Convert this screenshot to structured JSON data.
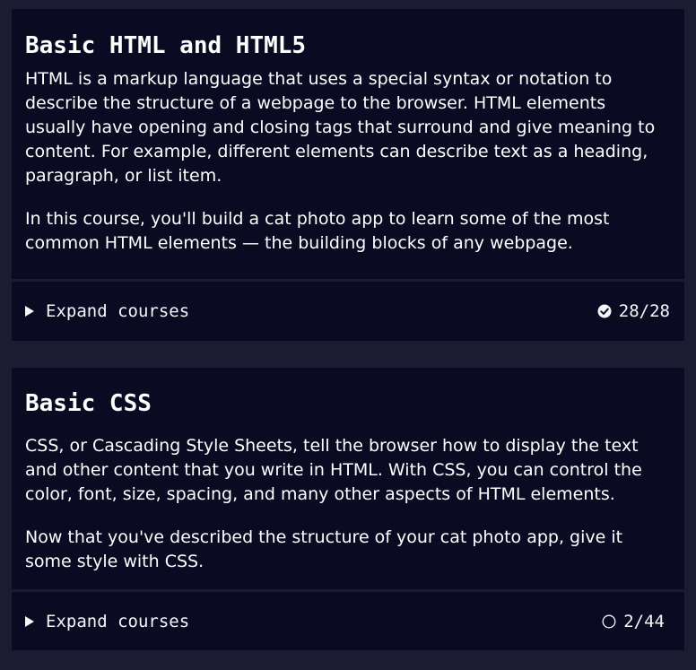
{
  "blocks": [
    {
      "title": "Basic HTML and HTML5",
      "paragraphs": [
        "HTML is a markup language that uses a special syntax or notation to describe the structure of a webpage to the browser. HTML elements usually have opening and closing tags that surround and give meaning to content. For example, different elements can describe text as a heading, paragraph, or list item.",
        "In this course, you'll build a cat photo app to learn some of the most common HTML elements — the building blocks of any webpage."
      ],
      "expand_label": "Expand courses",
      "progress": "28/28",
      "status_icon": "check-circle-icon"
    },
    {
      "title": "Basic CSS",
      "paragraphs": [
        "CSS, or Cascading Style Sheets, tell the browser how to display the text and other content that you write in HTML. With CSS, you can control the color, font, size, spacing, and many other aspects of HTML elements.",
        "Now that you've described the structure of your cat photo app, give it some style with CSS."
      ],
      "expand_label": "Expand courses",
      "progress": "2/44",
      "status_icon": "empty-circle-icon"
    }
  ],
  "colors": {
    "page_background": "#1b1b32",
    "card_background": "#0a0a23",
    "text": "#ffffff"
  }
}
